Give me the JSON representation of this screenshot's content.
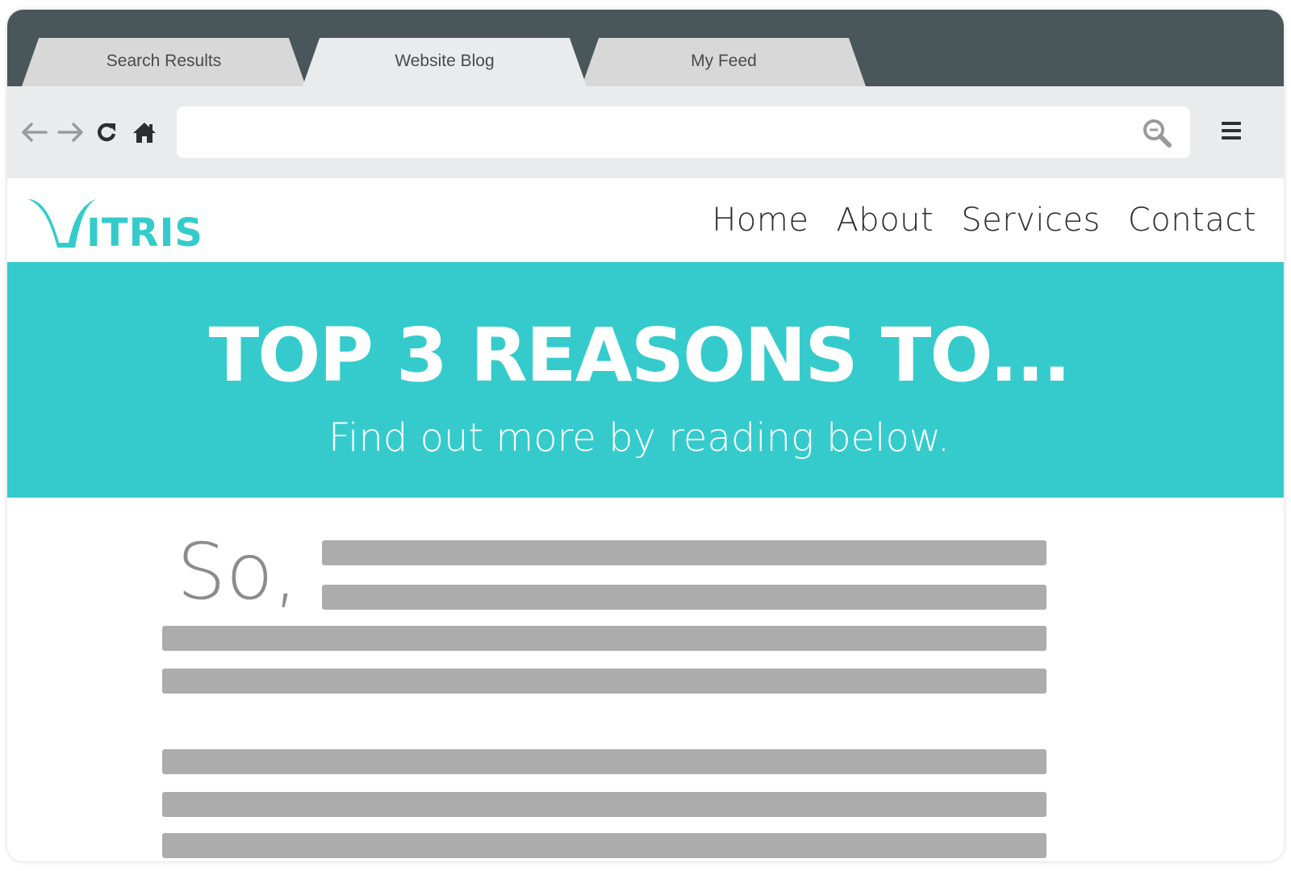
{
  "browser": {
    "tabs": [
      {
        "label": "Search Results",
        "active": false
      },
      {
        "label": "Website Blog",
        "active": true
      },
      {
        "label": "My Feed",
        "active": false
      }
    ],
    "address_bar": {
      "value": "",
      "placeholder": ""
    },
    "colors": {
      "tabbar": "#49565a",
      "toolbar": "#eaebec"
    }
  },
  "site": {
    "logo_text": "VITRIS",
    "nav": [
      "Home",
      "About",
      "Services",
      "Contact"
    ],
    "colors": {
      "accent": "#35cbcc"
    }
  },
  "hero": {
    "title": "TOP 3 REASONS TO...",
    "subtitle": "Find out more by reading below."
  },
  "article": {
    "dropcap": "So,"
  }
}
